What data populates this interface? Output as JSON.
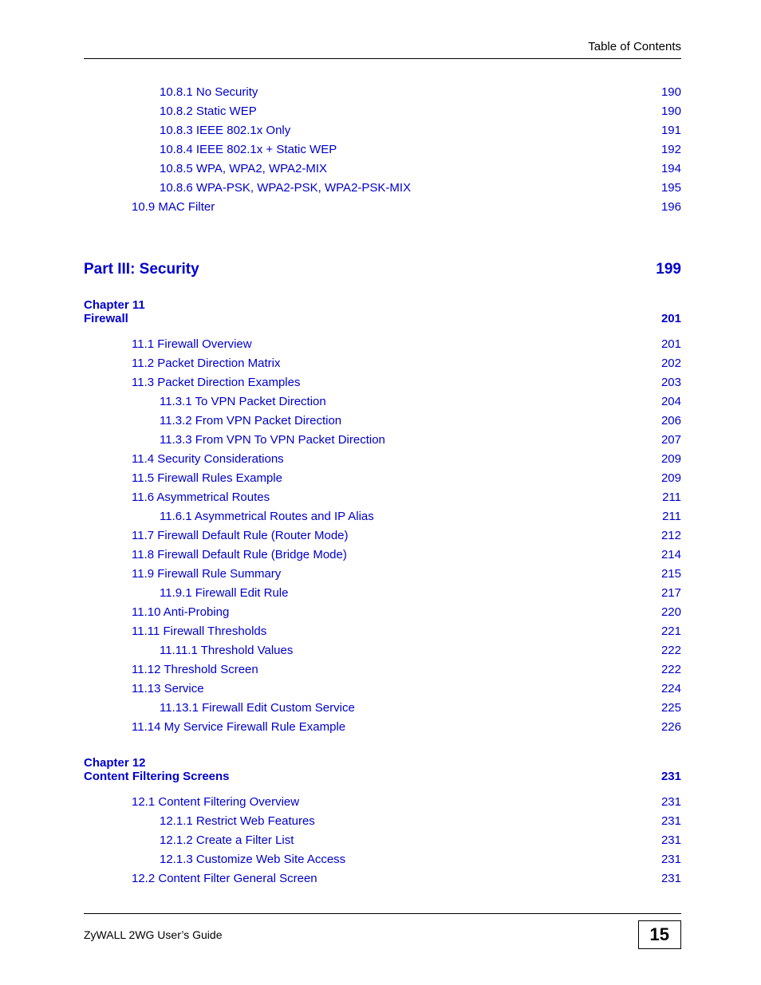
{
  "header": "Table of Contents",
  "pre_entries": [
    {
      "title": "10.8.1 No Security",
      "page": "190",
      "indent": 2
    },
    {
      "title": "10.8.2 Static WEP",
      "page": "190",
      "indent": 2
    },
    {
      "title": "10.8.3 IEEE 802.1x Only",
      "page": "191",
      "indent": 2
    },
    {
      "title": "10.8.4 IEEE 802.1x + Static WEP",
      "page": "192",
      "indent": 2
    },
    {
      "title": "10.8.5 WPA, WPA2, WPA2-MIX",
      "page": "194",
      "indent": 2
    },
    {
      "title": "10.8.6 WPA-PSK, WPA2-PSK, WPA2-PSK-MIX",
      "page": "195",
      "indent": 2
    },
    {
      "title": "10.9 MAC Filter",
      "page": "196",
      "indent": 1
    }
  ],
  "part": {
    "title": "Part III: Security",
    "page": "199"
  },
  "chapters": [
    {
      "label": "Chapter  11",
      "title": "Firewall",
      "page": "201",
      "entries": [
        {
          "title": "11.1 Firewall Overview",
          "page": "201",
          "indent": 1
        },
        {
          "title": "11.2 Packet Direction Matrix",
          "page": "202",
          "indent": 1
        },
        {
          "title": "11.3 Packet Direction Examples",
          "page": "203",
          "indent": 1
        },
        {
          "title": "11.3.1 To VPN Packet Direction",
          "page": "204",
          "indent": 2
        },
        {
          "title": "11.3.2 From VPN Packet Direction",
          "page": "206",
          "indent": 2
        },
        {
          "title": "11.3.3 From VPN To VPN Packet Direction",
          "page": "207",
          "indent": 2
        },
        {
          "title": "11.4 Security Considerations",
          "page": "209",
          "indent": 1
        },
        {
          "title": "11.5 Firewall Rules Example",
          "page": "209",
          "indent": 1
        },
        {
          "title": "11.6 Asymmetrical Routes",
          "page": "211",
          "indent": 1
        },
        {
          "title": "11.6.1 Asymmetrical Routes and IP Alias",
          "page": "211",
          "indent": 2
        },
        {
          "title": "11.7 Firewall Default Rule (Router Mode)",
          "page": "212",
          "indent": 1
        },
        {
          "title": "11.8 Firewall Default Rule (Bridge Mode)",
          "page": "214",
          "indent": 1
        },
        {
          "title": "11.9 Firewall Rule Summary",
          "page": "215",
          "indent": 1
        },
        {
          "title": "11.9.1 Firewall Edit Rule",
          "page": "217",
          "indent": 2
        },
        {
          "title": "11.10 Anti-Probing",
          "page": "220",
          "indent": 1
        },
        {
          "title": "11.11 Firewall Thresholds",
          "page": "221",
          "indent": 1
        },
        {
          "title": "11.11.1 Threshold Values",
          "page": "222",
          "indent": 2
        },
        {
          "title": "11.12 Threshold Screen",
          "page": "222",
          "indent": 1
        },
        {
          "title": "11.13 Service",
          "page": "224",
          "indent": 1
        },
        {
          "title": "11.13.1 Firewall Edit Custom Service",
          "page": "225",
          "indent": 2
        },
        {
          "title": "11.14 My Service Firewall Rule Example",
          "page": "226",
          "indent": 1
        }
      ]
    },
    {
      "label": "Chapter  12",
      "title": "Content Filtering Screens",
      "page": "231",
      "entries": [
        {
          "title": "12.1 Content Filtering Overview",
          "page": "231",
          "indent": 1
        },
        {
          "title": "12.1.1 Restrict Web Features",
          "page": "231",
          "indent": 2
        },
        {
          "title": "12.1.2 Create a Filter List",
          "page": "231",
          "indent": 2
        },
        {
          "title": "12.1.3 Customize Web Site Access",
          "page": "231",
          "indent": 2
        },
        {
          "title": "12.2 Content Filter General Screen",
          "page": "231",
          "indent": 1
        }
      ]
    }
  ],
  "footer": {
    "guide": "ZyWALL 2WG User’s Guide",
    "page": "15"
  }
}
